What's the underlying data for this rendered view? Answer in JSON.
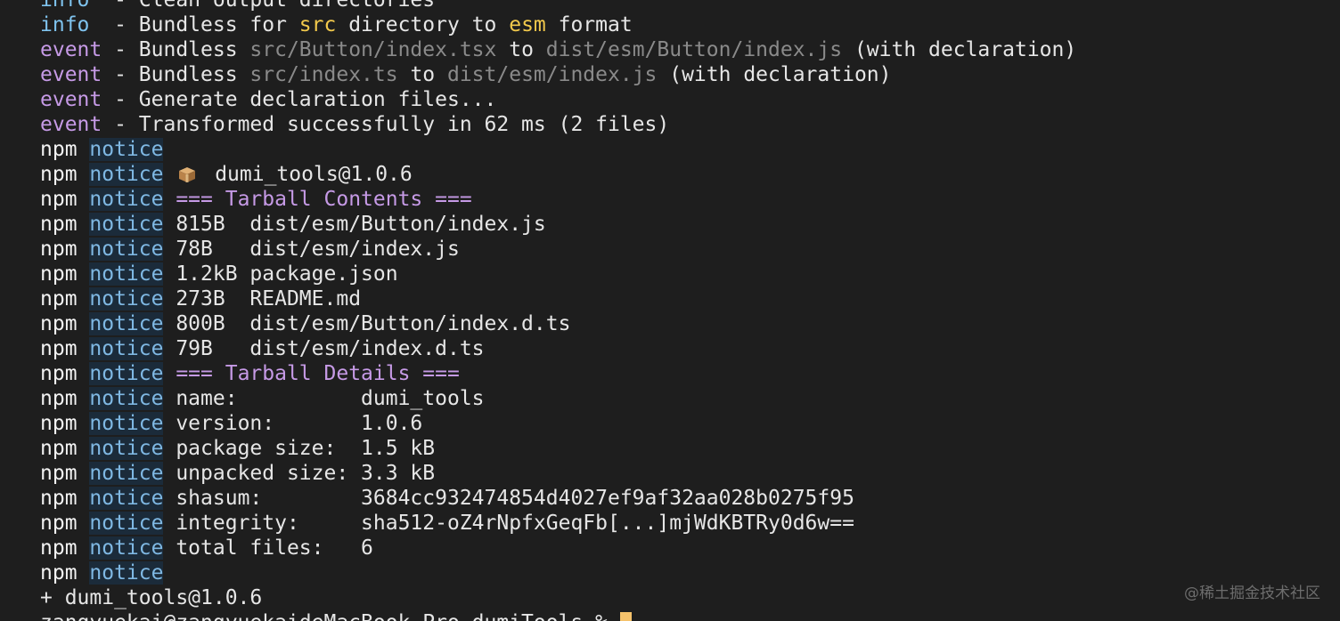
{
  "terminal": {
    "lines": [
      {
        "segments": [
          {
            "cls": "c-info",
            "text": "info"
          },
          {
            "cls": "c-plain",
            "text": "  - Clean output directories"
          }
        ]
      },
      {
        "segments": [
          {
            "cls": "c-info",
            "text": "info"
          },
          {
            "cls": "c-plain",
            "text": "  - Bundless for "
          },
          {
            "cls": "c-hl",
            "text": "src"
          },
          {
            "cls": "c-plain",
            "text": " directory to "
          },
          {
            "cls": "c-hl",
            "text": "esm"
          },
          {
            "cls": "c-plain",
            "text": " format"
          }
        ]
      },
      {
        "segments": [
          {
            "cls": "c-event",
            "text": "event"
          },
          {
            "cls": "c-plain",
            "text": " - Bundless "
          },
          {
            "cls": "c-dim",
            "text": "src/Button/index.tsx"
          },
          {
            "cls": "c-plain",
            "text": " to "
          },
          {
            "cls": "c-dim",
            "text": "dist/esm/Button/index.js"
          },
          {
            "cls": "c-plain",
            "text": " (with declaration)"
          }
        ]
      },
      {
        "segments": [
          {
            "cls": "c-event",
            "text": "event"
          },
          {
            "cls": "c-plain",
            "text": " - Bundless "
          },
          {
            "cls": "c-dim",
            "text": "src/index.ts"
          },
          {
            "cls": "c-plain",
            "text": " to "
          },
          {
            "cls": "c-dim",
            "text": "dist/esm/index.js"
          },
          {
            "cls": "c-plain",
            "text": " (with declaration)"
          }
        ]
      },
      {
        "segments": [
          {
            "cls": "c-event",
            "text": "event"
          },
          {
            "cls": "c-plain",
            "text": " - Generate declaration files..."
          }
        ]
      },
      {
        "segments": [
          {
            "cls": "c-event",
            "text": "event"
          },
          {
            "cls": "c-plain",
            "text": " - Transformed successfully in 62 ms (2 files)"
          }
        ]
      },
      {
        "segments": [
          {
            "cls": "c-npm",
            "text": "npm "
          },
          {
            "cls": "c-notice",
            "text": "notice"
          }
        ]
      },
      {
        "segments": [
          {
            "cls": "c-npm",
            "text": "npm "
          },
          {
            "cls": "c-notice",
            "text": "notice"
          },
          {
            "cls": "c-plain",
            "text": " "
          },
          {
            "cls": "icon",
            "text": "package-icon"
          },
          {
            "cls": "c-plain",
            "text": " dumi_tools@1.0.6"
          }
        ]
      },
      {
        "segments": [
          {
            "cls": "c-npm",
            "text": "npm "
          },
          {
            "cls": "c-notice",
            "text": "notice"
          },
          {
            "cls": "c-heading",
            "text": " === Tarball Contents ==="
          }
        ]
      },
      {
        "segments": [
          {
            "cls": "c-npm",
            "text": "npm "
          },
          {
            "cls": "c-notice",
            "text": "notice"
          },
          {
            "cls": "c-plain",
            "text": " 815B  dist/esm/Button/index.js"
          }
        ]
      },
      {
        "segments": [
          {
            "cls": "c-npm",
            "text": "npm "
          },
          {
            "cls": "c-notice",
            "text": "notice"
          },
          {
            "cls": "c-plain",
            "text": " 78B   dist/esm/index.js"
          }
        ]
      },
      {
        "segments": [
          {
            "cls": "c-npm",
            "text": "npm "
          },
          {
            "cls": "c-notice",
            "text": "notice"
          },
          {
            "cls": "c-plain",
            "text": " 1.2kB package.json"
          }
        ]
      },
      {
        "segments": [
          {
            "cls": "c-npm",
            "text": "npm "
          },
          {
            "cls": "c-notice",
            "text": "notice"
          },
          {
            "cls": "c-plain",
            "text": " 273B  README.md"
          }
        ]
      },
      {
        "segments": [
          {
            "cls": "c-npm",
            "text": "npm "
          },
          {
            "cls": "c-notice",
            "text": "notice"
          },
          {
            "cls": "c-plain",
            "text": " 800B  dist/esm/Button/index.d.ts"
          }
        ]
      },
      {
        "segments": [
          {
            "cls": "c-npm",
            "text": "npm "
          },
          {
            "cls": "c-notice",
            "text": "notice"
          },
          {
            "cls": "c-plain",
            "text": " 79B   dist/esm/index.d.ts"
          }
        ]
      },
      {
        "segments": [
          {
            "cls": "c-npm",
            "text": "npm "
          },
          {
            "cls": "c-notice",
            "text": "notice"
          },
          {
            "cls": "c-heading",
            "text": " === Tarball Details ==="
          }
        ]
      },
      {
        "segments": [
          {
            "cls": "c-npm",
            "text": "npm "
          },
          {
            "cls": "c-notice",
            "text": "notice"
          },
          {
            "cls": "c-plain",
            "text": " name:          dumi_tools"
          }
        ]
      },
      {
        "segments": [
          {
            "cls": "c-npm",
            "text": "npm "
          },
          {
            "cls": "c-notice",
            "text": "notice"
          },
          {
            "cls": "c-plain",
            "text": " version:       1.0.6"
          }
        ]
      },
      {
        "segments": [
          {
            "cls": "c-npm",
            "text": "npm "
          },
          {
            "cls": "c-notice",
            "text": "notice"
          },
          {
            "cls": "c-plain",
            "text": " package size:  1.5 kB"
          }
        ]
      },
      {
        "segments": [
          {
            "cls": "c-npm",
            "text": "npm "
          },
          {
            "cls": "c-notice",
            "text": "notice"
          },
          {
            "cls": "c-plain",
            "text": " unpacked size: 3.3 kB"
          }
        ]
      },
      {
        "segments": [
          {
            "cls": "c-npm",
            "text": "npm "
          },
          {
            "cls": "c-notice",
            "text": "notice"
          },
          {
            "cls": "c-plain",
            "text": " shasum:        3684cc932474854d4027ef9af32aa028b0275f95"
          }
        ]
      },
      {
        "segments": [
          {
            "cls": "c-npm",
            "text": "npm "
          },
          {
            "cls": "c-notice",
            "text": "notice"
          },
          {
            "cls": "c-plain",
            "text": " integrity:     sha512-oZ4rNpfxGeqFb[...]mjWdKBTRy0d6w=="
          }
        ]
      },
      {
        "segments": [
          {
            "cls": "c-npm",
            "text": "npm "
          },
          {
            "cls": "c-notice",
            "text": "notice"
          },
          {
            "cls": "c-plain",
            "text": " total files:   6"
          }
        ]
      },
      {
        "segments": [
          {
            "cls": "c-npm",
            "text": "npm "
          },
          {
            "cls": "c-notice",
            "text": "notice"
          }
        ]
      },
      {
        "segments": [
          {
            "cls": "c-plain",
            "text": "+ dumi_tools@1.0.6"
          }
        ]
      },
      {
        "segments": [
          {
            "cls": "c-plain",
            "text": "zangyuekai@zangyuekaideMacBook-Pro dumiTools % "
          },
          {
            "cls": "cursor",
            "text": ""
          }
        ]
      }
    ]
  },
  "watermark": "@稀土掘金技术社区"
}
